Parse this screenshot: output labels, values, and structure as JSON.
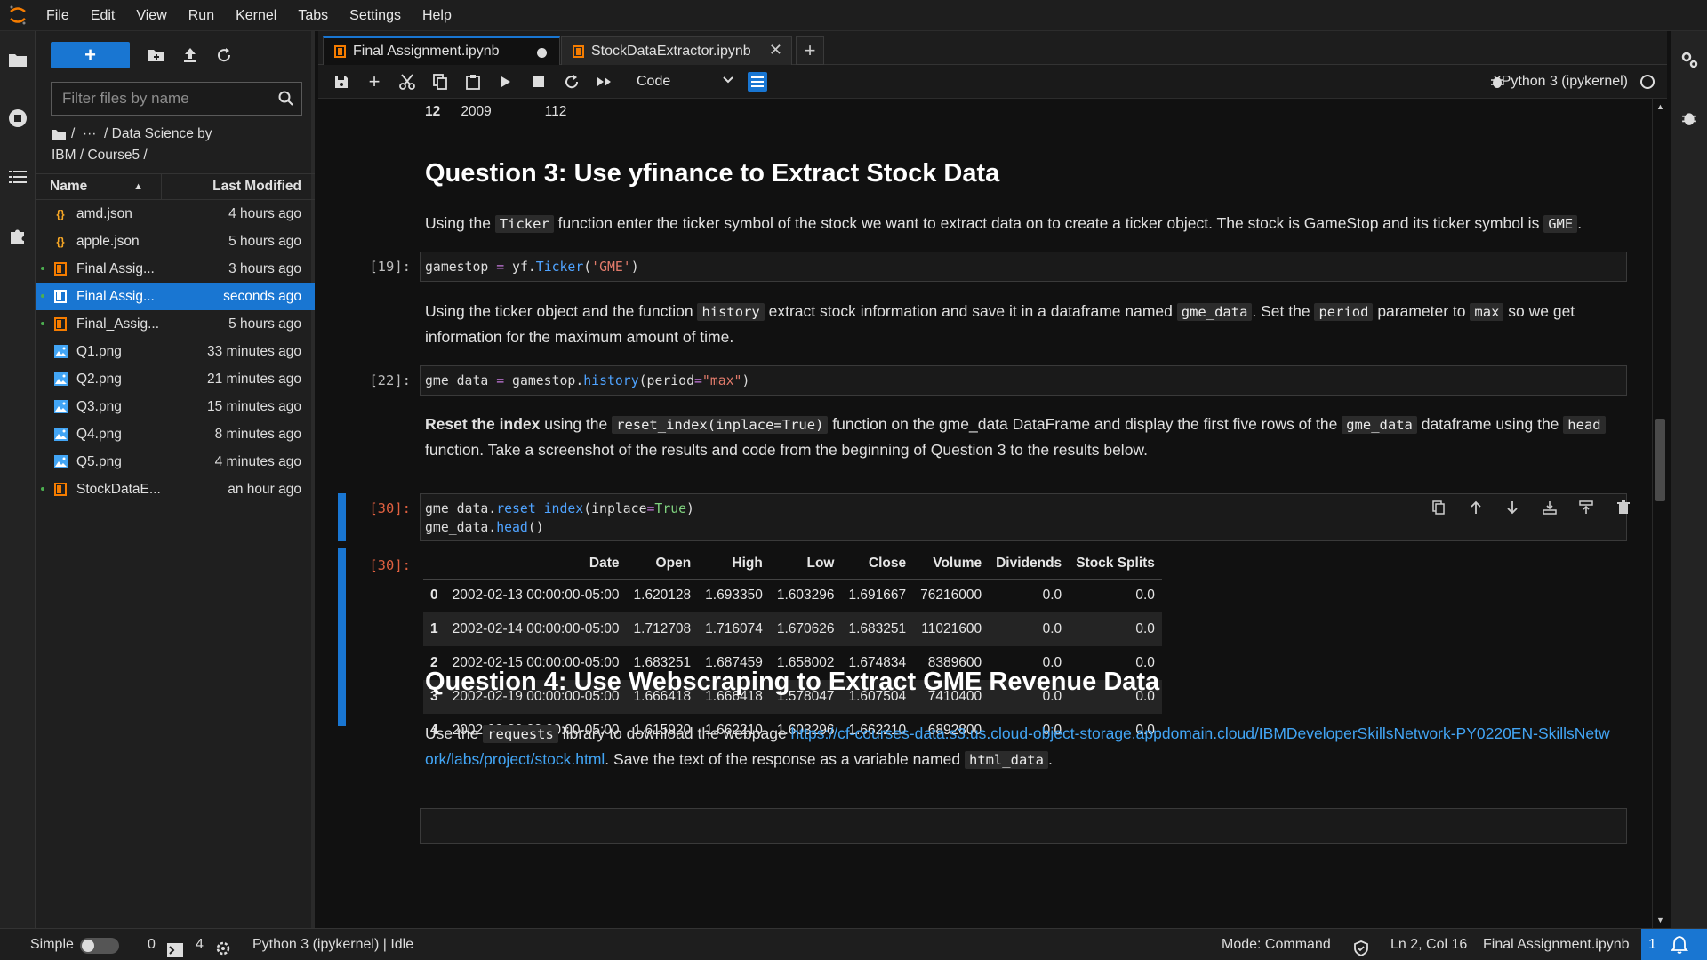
{
  "menu": [
    "File",
    "Edit",
    "View",
    "Run",
    "Kernel",
    "Tabs",
    "Settings",
    "Help"
  ],
  "filebrowser": {
    "new_label": "+",
    "filter_placeholder": "Filter files by name",
    "breadcrumb_line1": "/  ···  / Data Science by",
    "breadcrumb_line2": "IBM / Course5 /",
    "col_name": "Name",
    "col_modified": "Last Modified",
    "files": [
      {
        "name": "amd.json",
        "time": "4 hours ago",
        "type": "json",
        "running": false,
        "selected": false
      },
      {
        "name": "apple.json",
        "time": "5 hours ago",
        "type": "json",
        "running": false,
        "selected": false
      },
      {
        "name": "Final Assig...",
        "time": "3 hours ago",
        "type": "notebook",
        "running": true,
        "selected": false
      },
      {
        "name": "Final Assig...",
        "time": "seconds ago",
        "type": "notebook",
        "running": true,
        "selected": true
      },
      {
        "name": "Final_Assig...",
        "time": "5 hours ago",
        "type": "notebook",
        "running": true,
        "selected": false
      },
      {
        "name": "Q1.png",
        "time": "33 minutes ago",
        "type": "image",
        "running": false,
        "selected": false
      },
      {
        "name": "Q2.png",
        "time": "21 minutes ago",
        "type": "image",
        "running": false,
        "selected": false
      },
      {
        "name": "Q3.png",
        "time": "15 minutes ago",
        "type": "image",
        "running": false,
        "selected": false
      },
      {
        "name": "Q4.png",
        "time": "8 minutes ago",
        "type": "image",
        "running": false,
        "selected": false
      },
      {
        "name": "Q5.png",
        "time": "4 minutes ago",
        "type": "image",
        "running": false,
        "selected": false
      },
      {
        "name": "StockDataE...",
        "time": "an hour ago",
        "type": "notebook",
        "running": true,
        "selected": false
      }
    ]
  },
  "tabs": [
    {
      "label": "Final Assignment.ipynb",
      "active": true,
      "dirty": true
    },
    {
      "label": "StockDataExtractor.ipynb",
      "active": false,
      "dirty": false
    }
  ],
  "toolbar": {
    "cell_type": "Code",
    "kernel": "Python 3 (ipykernel)"
  },
  "notebook": {
    "prev_output": {
      "index": "12",
      "year": "2009",
      "value": "112"
    },
    "q3_heading": "Question 3: Use yfinance to Extract Stock Data",
    "q3_p1_a": "Using the ",
    "q3_p1_code1": "Ticker",
    "q3_p1_b": " function enter the ticker symbol of the stock we want to extract data on to create a ticker object. The stock is GameStop and its ticker symbol is ",
    "q3_p1_code2": "GME",
    "q3_p1_c": ".",
    "cell19_prompt": "[19]:",
    "cell19_code": {
      "var": "gamestop",
      "eq": "=",
      "mod": "yf",
      "fn": "Ticker",
      "arg": "'GME'"
    },
    "q3_p2_a": "Using the ticker object and the function ",
    "q3_p2_code1": "history",
    "q3_p2_b": " extract stock information and save it in a dataframe named ",
    "q3_p2_code2": "gme_data",
    "q3_p2_c": ". Set the ",
    "q3_p2_code3": "period",
    "q3_p2_d": " parameter to ",
    "q3_p2_code4": "max",
    "q3_p2_e": " so we get information for the maximum amount of time.",
    "cell22_prompt": "[22]:",
    "cell22_code": {
      "var": "gme_data",
      "eq": "=",
      "obj": "gamestop",
      "fn": "history",
      "param": "period",
      "arg": "\"max\""
    },
    "q3_p3_bold": "Reset the index",
    "q3_p3_a": " using the ",
    "q3_p3_code1": "reset_index(inplace=True)",
    "q3_p3_b": " function on the gme_data DataFrame and display the first five rows of the ",
    "q3_p3_code2": "gme_data",
    "q3_p3_c": " dataframe using the ",
    "q3_p3_code3": "head",
    "q3_p3_d": " function. Take a screenshot of the results and code from the beginning of Question 3 to the results below.",
    "cell30_prompt": "[30]:",
    "cell30_line1": {
      "obj": "gme_data",
      "fn": "reset_index",
      "param": "inplace",
      "val": "True"
    },
    "cell30_line2": {
      "obj": "gme_data",
      "fn": "head"
    },
    "out30_prompt": "[30]:",
    "table": {
      "columns": [
        "",
        "Date",
        "Open",
        "High",
        "Low",
        "Close",
        "Volume",
        "Dividends",
        "Stock Splits"
      ],
      "rows": [
        [
          "0",
          "2002-02-13 00:00:00-05:00",
          "1.620128",
          "1.693350",
          "1.603296",
          "1.691667",
          "76216000",
          "0.0",
          "0.0"
        ],
        [
          "1",
          "2002-02-14 00:00:00-05:00",
          "1.712708",
          "1.716074",
          "1.670626",
          "1.683251",
          "11021600",
          "0.0",
          "0.0"
        ],
        [
          "2",
          "2002-02-15 00:00:00-05:00",
          "1.683251",
          "1.687459",
          "1.658002",
          "1.674834",
          "8389600",
          "0.0",
          "0.0"
        ],
        [
          "3",
          "2002-02-19 00:00:00-05:00",
          "1.666418",
          "1.666418",
          "1.578047",
          "1.607504",
          "7410400",
          "0.0",
          "0.0"
        ],
        [
          "4",
          "2002-02-20 00:00:00-05:00",
          "1.615920",
          "1.662210",
          "1.603296",
          "1.662210",
          "6892800",
          "0.0",
          "0.0"
        ]
      ]
    },
    "q4_heading": "Question 4: Use Webscraping to Extract GME Revenue Data",
    "q4_p1_a": "Use the ",
    "q4_p1_code1": "requests",
    "q4_p1_b": " library to download the webpage ",
    "q4_link": "https://cf-courses-data.s3.us.cloud-object-storage.appdomain.cloud/IBMDeveloperSkillsNetwork-PY0220EN-SkillsNetwork/labs/project/stock.html",
    "q4_p1_c": ". Save the text of the response as a variable named ",
    "q4_p1_code2": "html_data",
    "q4_p1_d": "."
  },
  "statusbar": {
    "mode_label": "Simple",
    "terminals": "0",
    "kernels": "4",
    "kernel_status": "Python 3 (ipykernel) | Idle",
    "mode": "Mode: Command",
    "cursor": "Ln 2, Col 16",
    "file": "Final Assignment.ipynb",
    "notifications": "1"
  },
  "colors": {
    "accent": "#1976d2",
    "notebook_icon": "#f57c00",
    "json_icon": "#f9a825",
    "image_icon": "#42a5f5"
  }
}
